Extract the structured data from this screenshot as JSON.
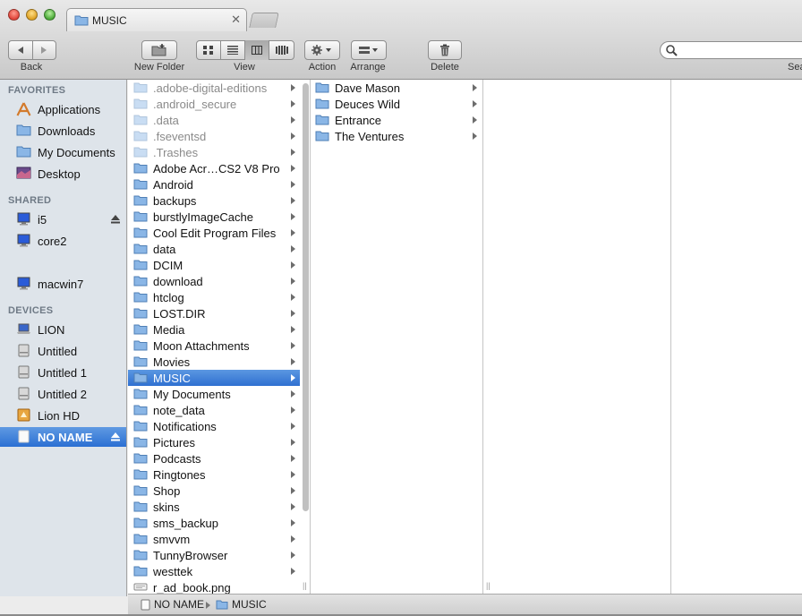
{
  "window": {
    "tab_title": "MUSIC",
    "tab_close": "✕"
  },
  "toolbar": {
    "back_label": "Back",
    "new_folder_label": "New Folder",
    "view_label": "View",
    "action_label": "Action",
    "arrange_label": "Arrange",
    "delete_label": "Delete",
    "search_label": "Sea",
    "search_placeholder": "",
    "active_view": "columns"
  },
  "sidebar": {
    "favorites_heading": "FAVORITES",
    "favorites": [
      {
        "label": "Applications",
        "icon": "applications-icon"
      },
      {
        "label": "Downloads",
        "icon": "folder-icon"
      },
      {
        "label": "My Documents",
        "icon": "folder-icon"
      },
      {
        "label": "Desktop",
        "icon": "desktop-icon"
      }
    ],
    "shared_heading": "SHARED",
    "shared": [
      {
        "label": "i5",
        "icon": "computer-icon"
      },
      {
        "label": "core2",
        "icon": "computer-icon"
      },
      {
        "label": "macwin7",
        "icon": "computer-icon"
      }
    ],
    "devices_heading": "DEVICES",
    "devices": [
      {
        "label": "LION",
        "icon": "laptop-icon"
      },
      {
        "label": "Untitled",
        "icon": "drive-icon"
      },
      {
        "label": "Untitled 1",
        "icon": "drive-icon"
      },
      {
        "label": "Untitled 2",
        "icon": "drive-icon"
      },
      {
        "label": "Lion HD",
        "icon": "drive-icon"
      },
      {
        "label": "NO NAME",
        "icon": "drive-icon"
      }
    ]
  },
  "column1": [
    {
      "label": ".adobe-digital-editions",
      "hidden": true
    },
    {
      "label": ".android_secure",
      "hidden": true
    },
    {
      "label": ".data",
      "hidden": true
    },
    {
      "label": ".fseventsd",
      "hidden": true
    },
    {
      "label": ".Trashes",
      "hidden": true
    },
    {
      "label": "Adobe Acr…CS2 V8 Pro"
    },
    {
      "label": "Android"
    },
    {
      "label": "backups"
    },
    {
      "label": "burstlyImageCache"
    },
    {
      "label": "Cool Edit Program Files"
    },
    {
      "label": "data"
    },
    {
      "label": "DCIM"
    },
    {
      "label": "download"
    },
    {
      "label": "htclog"
    },
    {
      "label": "LOST.DIR"
    },
    {
      "label": "Media"
    },
    {
      "label": "Moon Attachments"
    },
    {
      "label": "Movies"
    },
    {
      "label": "MUSIC",
      "selected": true
    },
    {
      "label": "My Documents"
    },
    {
      "label": "note_data"
    },
    {
      "label": "Notifications"
    },
    {
      "label": "Pictures"
    },
    {
      "label": "Podcasts"
    },
    {
      "label": "Ringtones"
    },
    {
      "label": "Shop"
    },
    {
      "label": "skins"
    },
    {
      "label": "sms_backup"
    },
    {
      "label": "smvvm"
    },
    {
      "label": "TunnyBrowser"
    },
    {
      "label": "westtek"
    },
    {
      "label": "r_ad_book.png",
      "file": true
    }
  ],
  "column2": [
    {
      "label": "Dave Mason"
    },
    {
      "label": "Deuces Wild"
    },
    {
      "label": "Entrance"
    },
    {
      "label": "The Ventures"
    }
  ],
  "pathbar": {
    "drive": "NO NAME",
    "folder": "MUSIC"
  },
  "colors": {
    "selection": "#2f70d1",
    "sidebar_bg": "#dee4ea",
    "folder_blue": "#8ab6e6"
  }
}
